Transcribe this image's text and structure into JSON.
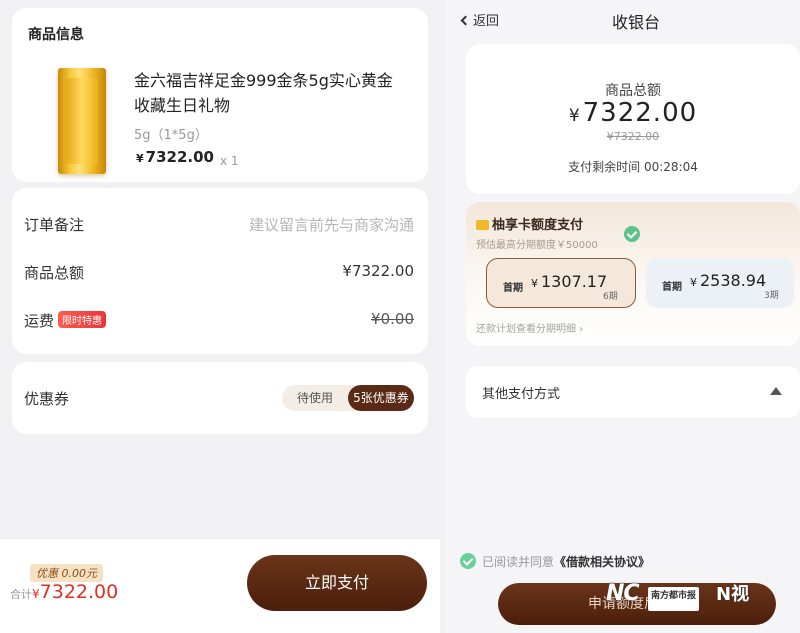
{
  "order": {
    "product_section_title": "商品信息",
    "product_name": "金六福吉祥足金999金条5g实心黄金收藏生日礼物",
    "product_spec": "5g（1*5g）",
    "product_price_symbol": "¥",
    "product_price": "7322.00",
    "product_qty": "x 1",
    "remark_label": "订单备注",
    "remark_placeholder": "建议留言前先与商家沟通",
    "subtotal_label": "商品总额",
    "subtotal_value": "¥7322.00",
    "shipping_label": "运费",
    "shipping_badge": "限时特惠",
    "shipping_value": "¥0.00",
    "coupon_label": "优惠券",
    "coupon_pending": "待使用",
    "coupon_count": "5张优惠券",
    "discount_tag": "优惠 0.00元",
    "total_prefix": "合计",
    "total_symbol": "¥",
    "total_value": "7322.00",
    "pay_button": "立即支付"
  },
  "cashier": {
    "back_label": "返回",
    "title": "收银台",
    "amount_label": "商品总额",
    "amount_symbol": "¥",
    "amount_value": "7322.00",
    "amount_original": "¥7322.00",
    "timer_text": "支付剩余时间 00:28:04",
    "card_pay_title": "柚享卡额度支付",
    "card_pay_subtitle": "预估最高分期额度￥50000",
    "plans": [
      {
        "first_label": "首期",
        "symbol": "¥",
        "amount": "1307.17",
        "periods": "6期",
        "selected": true
      },
      {
        "first_label": "首期",
        "symbol": "¥",
        "amount": "2538.94",
        "periods": "3期",
        "selected": false
      }
    ],
    "plan_footnote": "还款计划查看分期明细 ›",
    "other_methods_label": "其他支付方式",
    "agree_prefix": "已阅读并同意",
    "agree_link": "《借款相关协议》",
    "apply_button": "申请额度后支付"
  },
  "watermark": {
    "nc": "NC",
    "paper": "南方都市报",
    "n_video": "N视"
  },
  "icons": [
    "chevron-left-icon",
    "check-circle-icon",
    "card-folder-icon",
    "caret-up-icon",
    "gold-bar-image"
  ],
  "colors": {
    "brand_brown": "#5a2a16",
    "price_red": "#e02e24",
    "check_green": "#5cc489"
  }
}
